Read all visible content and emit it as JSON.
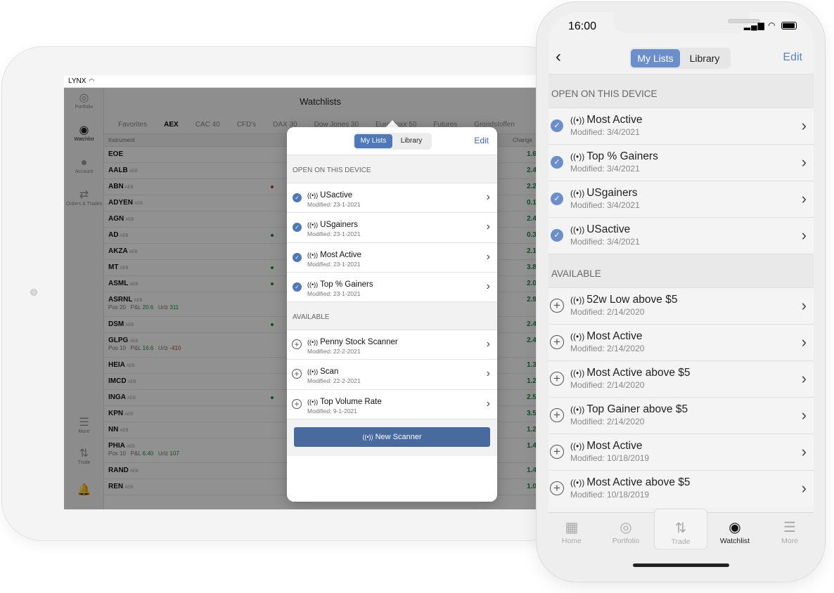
{
  "tablet": {
    "status": {
      "carrier": "LYNX",
      "wifi_icon": "wifi-icon"
    },
    "sidebar": [
      {
        "label": "Portfolio",
        "icon": "portfolio-icon"
      },
      {
        "label": "Watchlist",
        "icon": "eye-icon",
        "active": true
      },
      {
        "label": "Account",
        "icon": "account-icon"
      },
      {
        "label": "Orders & Trades",
        "icon": "orders-icon"
      },
      {
        "label": "More",
        "icon": "menu-icon"
      },
      {
        "label": "Trade",
        "icon": "trade-icon"
      },
      {
        "label": "",
        "icon": "bell-icon"
      }
    ],
    "title": "Watchlists",
    "tabs": [
      "Favorites",
      "AEX",
      "CAC 40",
      "CFD's",
      "DAX 30",
      "Dow Jones 30",
      "Eurostoxx 50",
      "Futures",
      "Grondstoffen"
    ],
    "active_tab": "AEX",
    "columns": {
      "instrument": "Instrument",
      "change": "Change"
    },
    "rows": [
      {
        "symbol": "EOE",
        "exch": "",
        "change": "1.6"
      },
      {
        "symbol": "AALB",
        "exch": "AEB",
        "change": "2.4"
      },
      {
        "symbol": "ABN",
        "exch": "AEB",
        "change": "2.2",
        "dot": "red"
      },
      {
        "symbol": "ADYEN",
        "exch": "AEB",
        "change": "0.1"
      },
      {
        "symbol": "AGN",
        "exch": "AEB",
        "change": "2.4"
      },
      {
        "symbol": "AD",
        "exch": "AEB",
        "change": "0.3",
        "dot": "green"
      },
      {
        "symbol": "AKZA",
        "exch": "AEB",
        "change": "2.1"
      },
      {
        "symbol": "MT",
        "exch": "AEB",
        "change": "3.8",
        "dot": "green"
      },
      {
        "symbol": "ASML",
        "exch": "AEB",
        "change": "2.0",
        "dot": "green"
      },
      {
        "symbol": "ASRNL",
        "exch": "AEB",
        "change": "2.9",
        "pos": "20",
        "pl": "20.6",
        "urlz": "311",
        "urlz_neg": false
      },
      {
        "symbol": "DSM",
        "exch": "AEB",
        "change": "2.4",
        "dot": "green"
      },
      {
        "symbol": "GLPG",
        "exch": "AEB",
        "change": "2.4",
        "pos": "10",
        "pl": "16.6",
        "urlz": "-410",
        "urlz_neg": true
      },
      {
        "symbol": "HEIA",
        "exch": "AEB",
        "change": "1.3"
      },
      {
        "symbol": "IMCD",
        "exch": "AEB",
        "change": "1.2"
      },
      {
        "symbol": "INGA",
        "exch": "AEB",
        "change": "2.5",
        "dot": "green"
      },
      {
        "symbol": "KPN",
        "exch": "AEB",
        "change": "3.5"
      },
      {
        "symbol": "NN",
        "exch": "AEB",
        "change": "1.2"
      },
      {
        "symbol": "PHIA",
        "exch": "AEB",
        "change": "1.4",
        "pos": "10",
        "pl": "6.40",
        "urlz": "107",
        "urlz_neg": false
      },
      {
        "symbol": "RAND",
        "exch": "AEB",
        "change": "1.4"
      },
      {
        "symbol": "REN",
        "exch": "AEB",
        "change": "1.0"
      }
    ],
    "labels": {
      "pos": "Pos",
      "pl": "P&L",
      "urlz": "Urlz"
    },
    "popover": {
      "seg_left": "My Lists",
      "seg_right": "Library",
      "edit": "Edit",
      "section_open": "OPEN ON THIS DEVICE",
      "open_items": [
        {
          "name": "USactive",
          "modified": "Modified: 23-1-2021"
        },
        {
          "name": "USgainers",
          "modified": "Modified: 23-1-2021"
        },
        {
          "name": "Most Active",
          "modified": "Modified: 23-1-2021"
        },
        {
          "name": "Top % Gainers",
          "modified": "Modified: 23-1-2021"
        }
      ],
      "section_available": "AVAILABLE",
      "available_items": [
        {
          "name": "Penny Stock Scanner",
          "modified": "Modified: 22-2-2021"
        },
        {
          "name": "Scan",
          "modified": "Modified: 22-2-2021"
        },
        {
          "name": "Top Volume Rate",
          "modified": "Modified: 9-1-2021"
        }
      ],
      "new_scanner": "New Scanner"
    }
  },
  "phone": {
    "time": "16:00",
    "seg_left": "My Lists",
    "seg_right": "Library",
    "edit": "Edit",
    "section_open": "OPEN ON THIS DEVICE",
    "open_items": [
      {
        "name": "Most Active",
        "modified": "Modified: 3/4/2021"
      },
      {
        "name": "Top % Gainers",
        "modified": "Modified: 3/4/2021"
      },
      {
        "name": "USgainers",
        "modified": "Modified: 3/4/2021"
      },
      {
        "name": "USactive",
        "modified": "Modified: 3/4/2021"
      }
    ],
    "section_available": "AVAILABLE",
    "available_items": [
      {
        "name": "52w Low above $5",
        "modified": "Modified: 2/14/2020"
      },
      {
        "name": "Most Active",
        "modified": "Modified: 2/14/2020"
      },
      {
        "name": "Most Active above $5",
        "modified": "Modified: 2/14/2020"
      },
      {
        "name": "Top Gainer above $5",
        "modified": "Modified: 2/14/2020"
      },
      {
        "name": "Most Active",
        "modified": "Modified: 10/18/2019"
      },
      {
        "name": "Most Active above $5",
        "modified": "Modified: 10/18/2019"
      }
    ],
    "tabs": [
      {
        "label": "Home",
        "icon": "home-icon"
      },
      {
        "label": "Portfolio",
        "icon": "portfolio-icon"
      },
      {
        "label": "Trade",
        "icon": "trade-icon"
      },
      {
        "label": "Watchlist",
        "icon": "eye-icon",
        "active": true
      },
      {
        "label": "More",
        "icon": "menu-icon"
      }
    ]
  },
  "colors": {
    "accent": "#4e78b8",
    "phone_accent": "#6b8fca",
    "positive": "#1a8a3c",
    "negative": "#c0392b"
  }
}
